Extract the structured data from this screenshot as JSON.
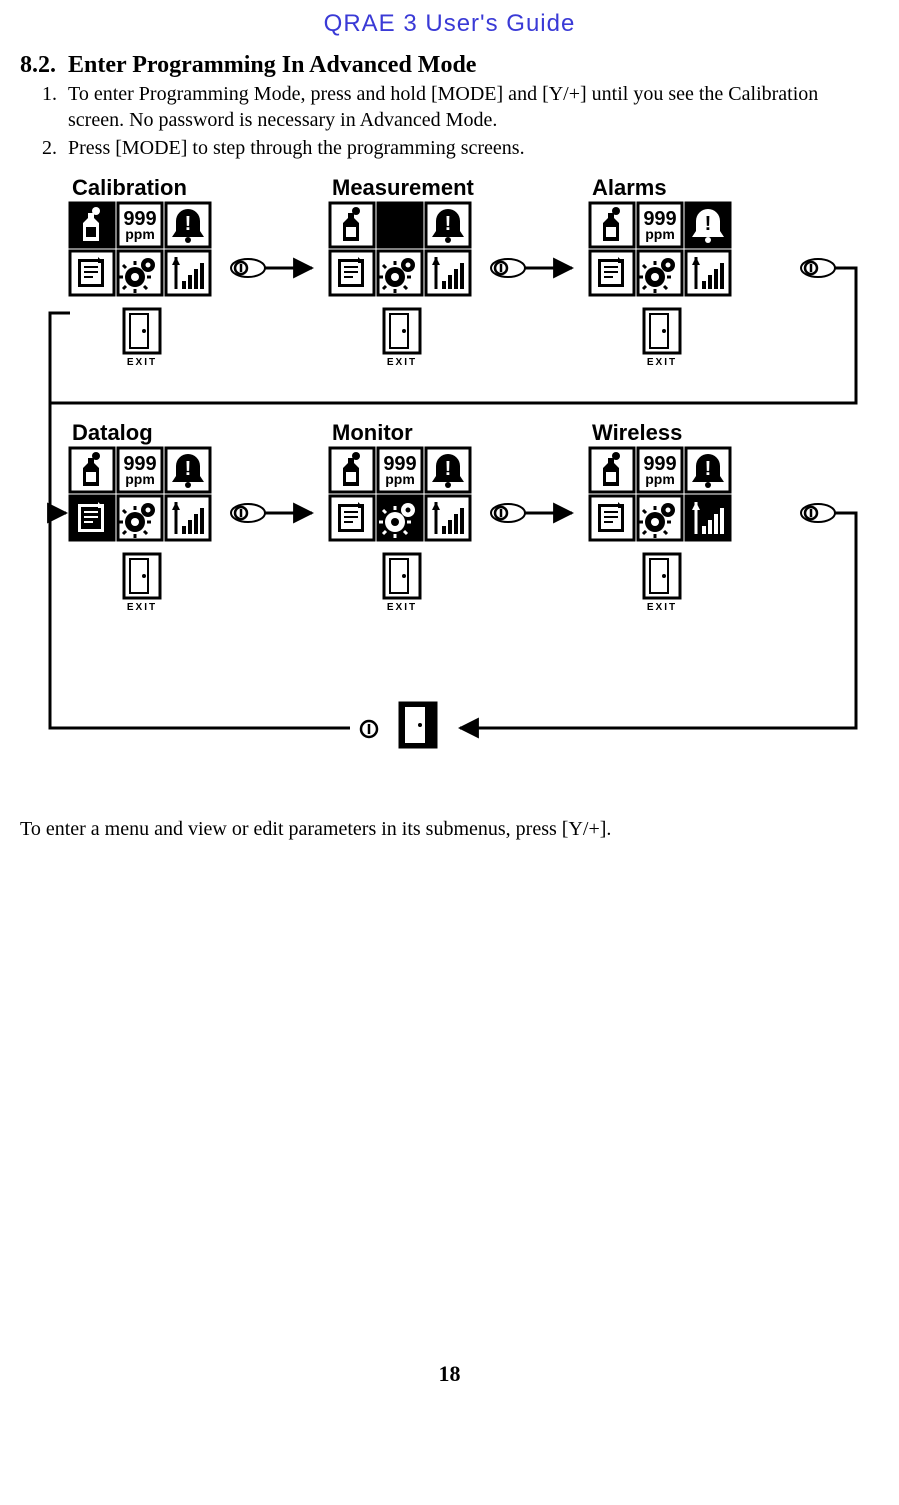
{
  "doc": {
    "title": "QRAE 3 User's Guide",
    "page_number": "18"
  },
  "section": {
    "number": "8.2.",
    "heading": "Enter Programming In Advanced Mode",
    "steps": [
      "To enter Programming Mode, press and hold [MODE] and [Y/+] until  you see the Calibration screen. No password is necessary in Advanced Mode.",
      "Press [MODE] to step through the programming screens."
    ],
    "closing": "To enter a menu and view or edit parameters in its submenus, press [Y/+]."
  },
  "diagram": {
    "screens": [
      {
        "label": "Calibration",
        "highlight": 0
      },
      {
        "label": "Measurement",
        "highlight": 1
      },
      {
        "label": "Alarms",
        "highlight": 2
      },
      {
        "label": "Datalog",
        "highlight": 3
      },
      {
        "label": "Monitor",
        "highlight": 4
      },
      {
        "label": "Wireless",
        "highlight": 5
      }
    ],
    "icon_value": "999",
    "icon_unit": "ppm",
    "exit_label": "EXIT"
  }
}
